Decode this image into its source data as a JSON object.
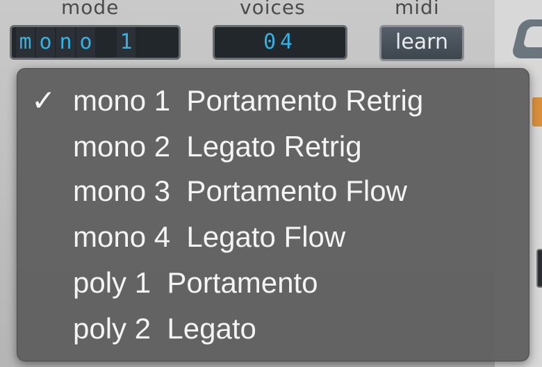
{
  "header": {
    "mode_label": "mode",
    "voices_label": "voices",
    "midi_label": "midi"
  },
  "mode_display": {
    "chars": [
      "m",
      "o",
      "n",
      "o",
      "",
      "1",
      "",
      ""
    ]
  },
  "voices_display": {
    "value": "04"
  },
  "midi": {
    "learn_label": "learn"
  },
  "mode_menu": {
    "check_mark": "✓",
    "selected_index": 0,
    "items": [
      {
        "label": "mono 1  Portamento Retrig"
      },
      {
        "label": "mono 2  Legato Retrig"
      },
      {
        "label": "mono 3  Portamento Flow"
      },
      {
        "label": "mono 4  Legato Flow"
      },
      {
        "label": "poly 1  Portamento"
      },
      {
        "label": "poly 2  Legato"
      }
    ]
  },
  "colors": {
    "lcd_text": "#2fb4e8",
    "menu_bg": "#606060",
    "menu_text": "#f4f4f4"
  }
}
